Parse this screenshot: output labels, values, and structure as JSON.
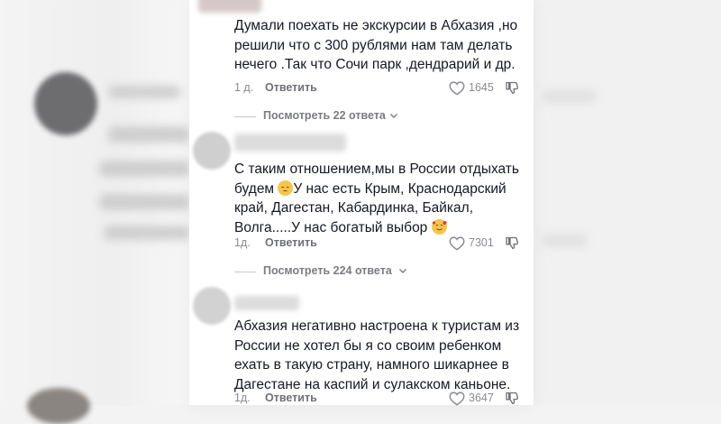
{
  "comments": [
    {
      "text": "Думали поехать не экскурсии в Абхазия ,но решили что с 300 рублями нам там делать нечего .Так что Сочи парк ,дендрарий и др.",
      "time": "1 д.",
      "reply_label": "Ответить",
      "likes": "1645",
      "replies_label": "Посмотреть 22 ответа"
    },
    {
      "text_part1": "С таким отношением,мы в России отдыхать будем ",
      "text_part2": "У нас есть Крым, Краснодарский край, Дагестан, Кабардинка, Байкал, Волга.....У нас богатый выбор ",
      "time": "1д.",
      "reply_label": "Ответить",
      "likes": "7301",
      "replies_label": "Посмотреть 224 ответа"
    },
    {
      "text": "Абхазия негативно настроена к туристам из России не хотел бы я со своим ребенком ехать в такую страну, намного шикарнее в Дагестане на каспий и сулакском каньоне.",
      "time": "1д.",
      "reply_label": "Ответить",
      "likes": "3647"
    }
  ],
  "icons": {
    "like": "heart-outline-icon",
    "dislike": "thumbs-down-icon",
    "expand": "chevron-down-icon",
    "emoji1": "pensive-face-emoji",
    "emoji2": "smiling-face-with-hearts-emoji"
  },
  "colors": {
    "text": "#161823",
    "muted": "#8a8b91",
    "background": "#ffffff"
  }
}
